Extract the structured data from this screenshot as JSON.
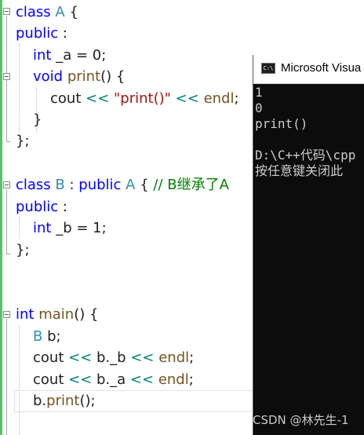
{
  "editor": {
    "lines": [
      {
        "row": 0,
        "parts": [
          [
            "kw",
            "class "
          ],
          [
            "ty",
            "A"
          ],
          [
            "var",
            " {"
          ]
        ]
      },
      {
        "row": 1,
        "parts": [
          [
            "kw",
            "public"
          ],
          [
            "var",
            " :"
          ]
        ]
      },
      {
        "row": 2,
        "parts": [
          [
            "kw",
            "int"
          ],
          [
            "var",
            " _a = 0;"
          ]
        ]
      },
      {
        "row": 3,
        "parts": [
          [
            "kw",
            "void"
          ],
          [
            "var",
            " "
          ],
          [
            "fn",
            "print"
          ],
          [
            "var",
            "() {"
          ]
        ]
      },
      {
        "row": 4,
        "parts": [
          [
            "var",
            "cout "
          ],
          [
            "op",
            "<<"
          ],
          [
            "var",
            " "
          ],
          [
            "str",
            "\"print()\""
          ],
          [
            "var",
            " "
          ],
          [
            "op",
            "<<"
          ],
          [
            "var",
            " "
          ],
          [
            "fn",
            "endl"
          ],
          [
            "var",
            ";"
          ]
        ]
      },
      {
        "row": 5,
        "parts": [
          [
            "var",
            "}"
          ]
        ]
      },
      {
        "row": 6,
        "parts": [
          [
            "var",
            "};"
          ]
        ]
      },
      {
        "row": 8,
        "parts": [
          [
            "kw",
            "class "
          ],
          [
            "ty",
            "B"
          ],
          [
            "var",
            " : "
          ],
          [
            "kw",
            "public "
          ],
          [
            "ty",
            "A"
          ],
          [
            "var",
            " { "
          ],
          [
            "cm",
            "// B继承了A"
          ]
        ]
      },
      {
        "row": 9,
        "parts": [
          [
            "kw",
            "public"
          ],
          [
            "var",
            " :"
          ]
        ]
      },
      {
        "row": 10,
        "parts": [
          [
            "kw",
            "int"
          ],
          [
            "var",
            " _b = 1;"
          ]
        ]
      },
      {
        "row": 11,
        "parts": [
          [
            "var",
            "};"
          ]
        ]
      },
      {
        "row": 14,
        "parts": [
          [
            "kw",
            "int "
          ],
          [
            "fn",
            "main"
          ],
          [
            "var",
            "() {"
          ]
        ]
      },
      {
        "row": 15,
        "parts": [
          [
            "ty",
            "B"
          ],
          [
            "var",
            " b;"
          ]
        ]
      },
      {
        "row": 16,
        "parts": [
          [
            "var",
            "cout "
          ],
          [
            "op",
            "<<"
          ],
          [
            "var",
            " b."
          ],
          [
            "var",
            "_b "
          ],
          [
            "op",
            "<<"
          ],
          [
            "var",
            " "
          ],
          [
            "fn",
            "endl"
          ],
          [
            "var",
            ";"
          ]
        ]
      },
      {
        "row": 17,
        "parts": [
          [
            "var",
            "cout "
          ],
          [
            "op",
            "<<"
          ],
          [
            "var",
            " b."
          ],
          [
            "var",
            "_a "
          ],
          [
            "op",
            "<<"
          ],
          [
            "var",
            " "
          ],
          [
            "fn",
            "endl"
          ],
          [
            "var",
            ";"
          ]
        ]
      },
      {
        "row": 18,
        "parts": [
          [
            "var",
            "b."
          ],
          [
            "fn",
            "print"
          ],
          [
            "var",
            "();"
          ]
        ]
      }
    ]
  },
  "console": {
    "title": "Microsoft Visua",
    "icon_label": "C:\\",
    "output": [
      "1",
      "0",
      "print()",
      "",
      "D:\\C++代码\\cpp",
      "按任意键关闭此"
    ]
  },
  "watermark": "CSDN @林先生-1",
  "colors": {
    "keyword": "#0000ff",
    "type": "#2b91af",
    "function": "#74531f",
    "string": "#a31515",
    "operator": "#008080",
    "comment": "#008000",
    "gutter_green": "#57c26b",
    "console_bg": "#0c0c0c"
  }
}
